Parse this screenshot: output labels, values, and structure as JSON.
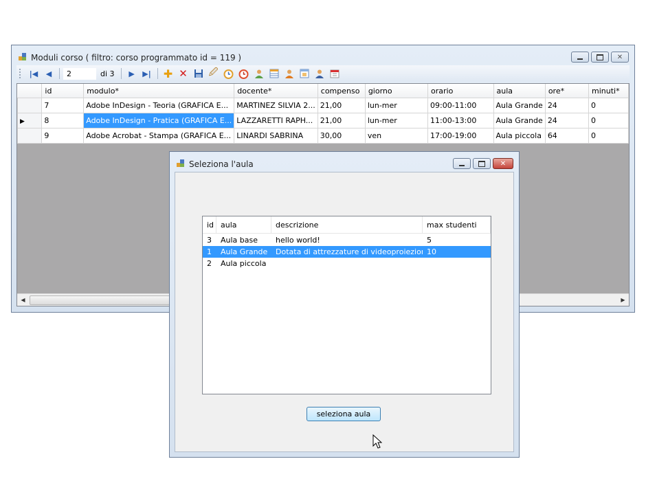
{
  "main_window": {
    "title": "Moduli corso ( filtro: corso programmato id = 119 )",
    "navigator": {
      "position": "2",
      "count": "di 3"
    },
    "grid": {
      "columns": [
        "id",
        "modulo*",
        "docente*",
        "compenso",
        "giorno",
        "orario",
        "aula",
        "ore*",
        "minuti*"
      ],
      "rows": [
        {
          "id": "7",
          "modulo": "Adobe InDesign - Teoria (GRAFICA E...",
          "docente": "MARTINEZ SILVIA 2...",
          "compenso": "21,00",
          "giorno": "lun-mer",
          "orario": "09:00-11:00",
          "aula": "Aula Grande",
          "ore": "24",
          "minuti": "0"
        },
        {
          "id": "8",
          "modulo": "Adobe InDesign - Pratica (GRAFICA E...",
          "docente": "LAZZARETTI RAPH...",
          "compenso": "21,00",
          "giorno": "lun-mer",
          "orario": "11:00-13:00",
          "aula": "Aula Grande",
          "ore": "24",
          "minuti": "0"
        },
        {
          "id": "9",
          "modulo": "Adobe Acrobat - Stampa (GRAFICA E...",
          "docente": "LINARDI SABRINA",
          "compenso": "30,00",
          "giorno": "ven",
          "orario": "17:00-19:00",
          "aula": "Aula piccola",
          "ore": "64",
          "minuti": "0"
        }
      ],
      "current_row": 1
    }
  },
  "dialog": {
    "title": "Seleziona l'aula",
    "list": {
      "columns": [
        "id",
        "aula",
        "descrizione",
        "max studenti"
      ],
      "rows": [
        {
          "id": "3",
          "aula": "Aula base",
          "descrizione": "hello world!",
          "max": "5"
        },
        {
          "id": "1",
          "aula": "Aula Grande",
          "descrizione": "Dotata di attrezzature di videoproiezione e...",
          "max": "10"
        },
        {
          "id": "2",
          "aula": "Aula piccola",
          "descrizione": "",
          "max": ""
        }
      ],
      "selected_row": 1
    },
    "select_button": "seleziona aula"
  },
  "colors": {
    "selection": "#3399ff",
    "grid_background": "#aaa9aa"
  }
}
